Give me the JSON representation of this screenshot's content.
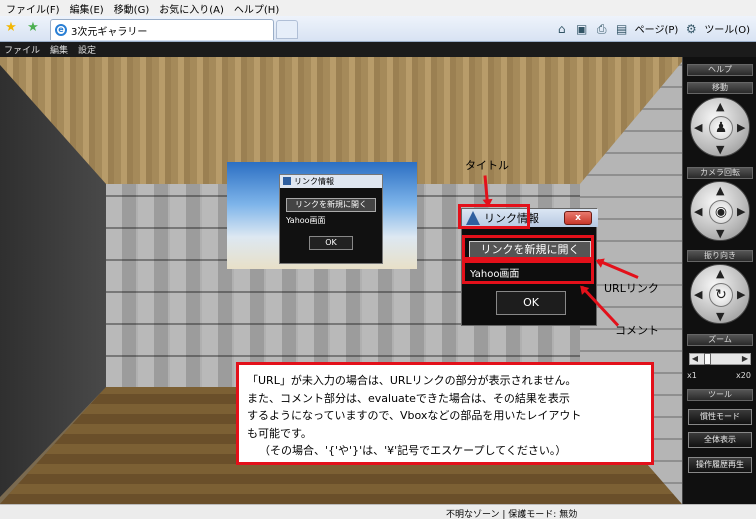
{
  "browser": {
    "menu": [
      "ファイル(F)",
      "編集(E)",
      "移動(G)",
      "お気に入り(A)",
      "ヘルプ(H)"
    ],
    "tab_title": "3次元ギャラリー",
    "tools": {
      "page_label": "ページ(P)",
      "tools_label": "ツール(O)"
    },
    "icons": {
      "favorites": "favorites-star-icon",
      "add_favorite": "add-favorite-icon",
      "home": "home-icon",
      "feeds": "rss-icon",
      "print": "printer-icon",
      "page": "page-icon",
      "tools": "gear-icon"
    }
  },
  "app_menu": [
    "ファイル",
    "編集",
    "設定"
  ],
  "painting_dialog": {
    "title": "リンク情報",
    "link": "リンクを新規に開く",
    "comment": "Yahoo画面",
    "ok": "OK"
  },
  "dialog": {
    "title": "リンク情報",
    "close": "x",
    "link": "リンクを新規に開く",
    "comment": "Yahoo画面",
    "ok": "OK"
  },
  "annotations": {
    "title_label": "タイトル",
    "url_link_label": "URLリンク",
    "comment_label": "コメント",
    "note_lines": [
      "「URL」が未入力の場合は、URLリンクの部分が表示されません。",
      "また、コメント部分は、evaluateできた場合は、その結果を表示",
      "するようになっていますので、Vboxなどの部品を用いたレイアウト",
      "も可能です。",
      "（その場合、'{'や'}'は、'¥'記号でエスケープしてください。）"
    ],
    "color": "#e3101a"
  },
  "panel": {
    "help": "ヘルプ",
    "move": "移動",
    "camera_rotate": "カメラ回転",
    "turn": "振り向き",
    "zoom": "ズーム",
    "zoom_min": "x1",
    "zoom_max": "x20",
    "zoom_level": 0.1,
    "tools": "ツール",
    "buttons": [
      "慣性モード",
      "全体表示",
      "操作履歴再生"
    ]
  },
  "status": "不明なゾーン | 保護モード: 無効"
}
